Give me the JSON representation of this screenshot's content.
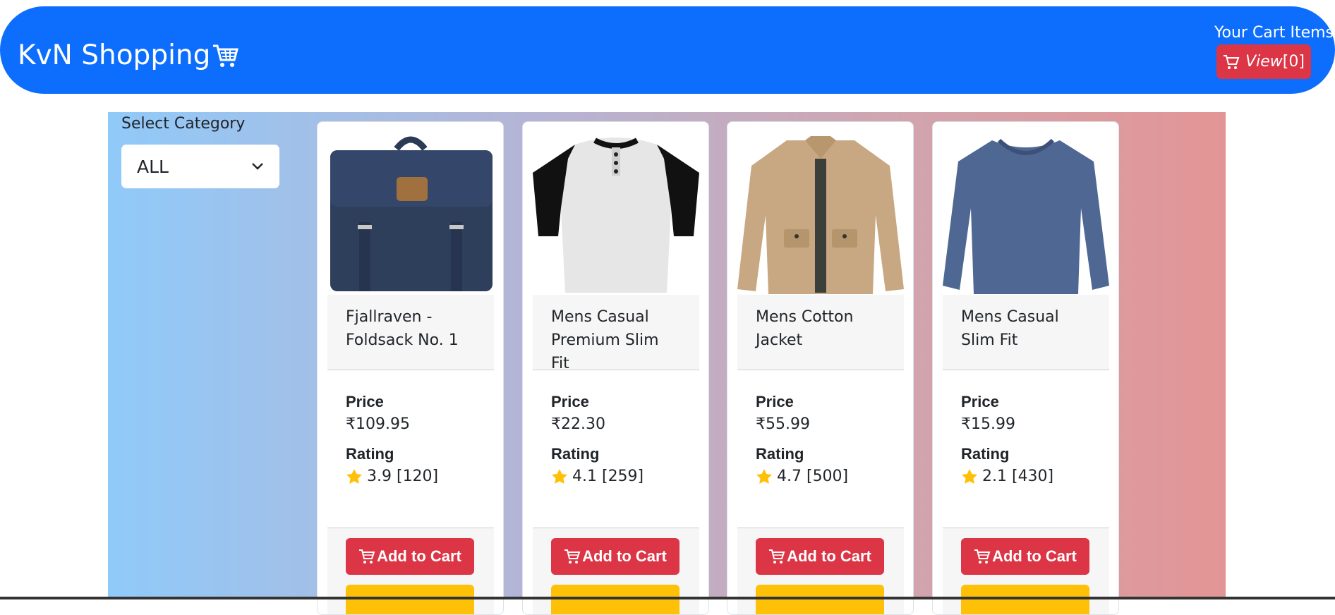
{
  "header": {
    "brand": "KvN Shopping",
    "cart_label": "Your Cart Items",
    "view_label": "View",
    "view_count": "[0]",
    "colors": {
      "primary": "#0d6efd",
      "danger": "#dc3545",
      "warning": "#ffc107"
    }
  },
  "sidebar": {
    "category_label": "Select Category",
    "category_selected": "ALL"
  },
  "products": [
    {
      "title_line1": "Fjallraven -",
      "title_line2": "Foldsack No. 1",
      "price_label": "Price",
      "price": "₹109.95",
      "rating_label": "Rating",
      "rating": "3.9 [120]",
      "add_label": "Add to Cart",
      "image_icon": "backpack-image"
    },
    {
      "title_line1": "Mens Casual",
      "title_line2": "Premium Slim Fit",
      "price_label": "Price",
      "price": "₹22.30",
      "rating_label": "Rating",
      "rating": "4.1 [259]",
      "add_label": "Add to Cart",
      "image_icon": "raglan-tshirt-image"
    },
    {
      "title_line1": "Mens Cotton",
      "title_line2": "Jacket",
      "price_label": "Price",
      "price": "₹55.99",
      "rating_label": "Rating",
      "rating": "4.7 [500]",
      "add_label": "Add to Cart",
      "image_icon": "jacket-image"
    },
    {
      "title_line1": "Mens Casual",
      "title_line2": "Slim Fit",
      "price_label": "Price",
      "price": "₹15.99",
      "rating_label": "Rating",
      "rating": "2.1 [430]",
      "add_label": "Add to Cart",
      "image_icon": "longsleeve-shirt-image"
    }
  ]
}
